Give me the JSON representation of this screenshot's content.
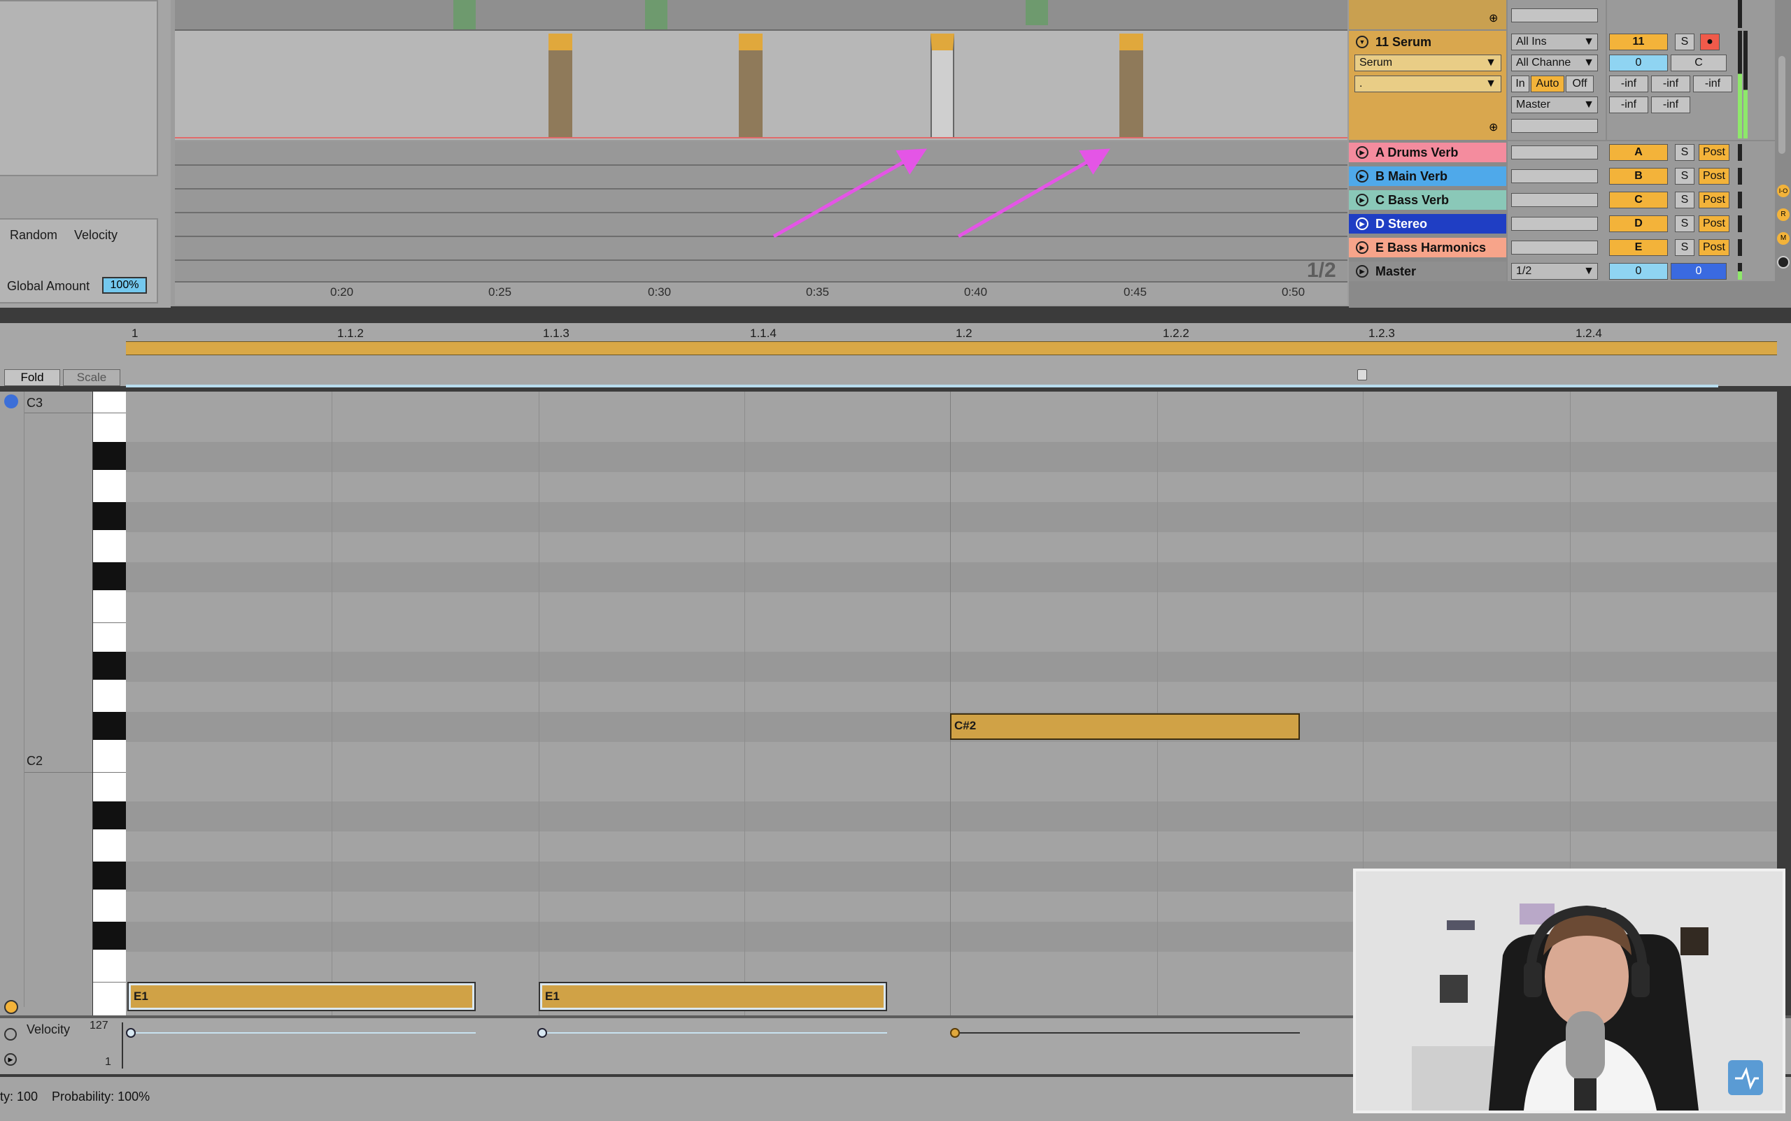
{
  "left_panel": {
    "random_label": "Random",
    "velocity_label": "Velocity",
    "global_amount_label": "Global Amount",
    "global_amount_value": "100%"
  },
  "arrangement": {
    "time_labels": [
      "0:20",
      "0:25",
      "0:30",
      "0:35",
      "0:40",
      "0:45",
      "0:50"
    ],
    "zoom_readout": "1/2",
    "annotation_arrow_color": "#e455e6"
  },
  "mixer": {
    "serum_track": {
      "name": "11 Serum",
      "instrument": "Serum",
      "sub_chain": ".",
      "input_type": "All Ins",
      "input_channel": "All Channe",
      "monitor_in": "In",
      "monitor_auto": "Auto",
      "monitor_off": "Off",
      "output": "Master",
      "track_number": "11",
      "solo": "S",
      "volume": "0",
      "pan": "C",
      "peak1": "-inf",
      "peak2": "-inf",
      "peak3": "-inf",
      "peak4": "-inf",
      "peak5": "-inf"
    },
    "returns": [
      {
        "name": "A Drums Verb",
        "letter": "A",
        "solo": "S",
        "mode": "Post",
        "color": "#f48c9e"
      },
      {
        "name": "B Main Verb",
        "letter": "B",
        "solo": "S",
        "mode": "Post",
        "color": "#4fa9ea"
      },
      {
        "name": "C Bass Verb",
        "letter": "C",
        "solo": "S",
        "mode": "Post",
        "color": "#8ac8b8"
      },
      {
        "name": "D Stereo",
        "letter": "D",
        "solo": "S",
        "mode": "Post",
        "color": "#1f3ec4"
      },
      {
        "name": "E Bass Harmonics",
        "letter": "E",
        "solo": "S",
        "mode": "Post",
        "color": "#f7a48a"
      }
    ],
    "master": {
      "name": "Master",
      "cue": "1/2",
      "volume": "0",
      "pan": "0"
    },
    "side_buttons": [
      "I-O",
      "R",
      "M"
    ]
  },
  "piano_roll": {
    "fold_label": "Fold",
    "scale_label": "Scale",
    "ruler_labels": [
      "1",
      "1.1.2",
      "1.1.3",
      "1.1.4",
      "1.2",
      "1.2.2",
      "1.2.3",
      "1.2.4"
    ],
    "octave_labels": [
      "C3",
      "C2"
    ],
    "notes": [
      {
        "label": "C#2"
      },
      {
        "label": "E1"
      },
      {
        "label": "E1"
      }
    ],
    "note_color": "#d0a246"
  },
  "velocity_lane": {
    "label": "Velocity",
    "max": "127",
    "min": "1"
  },
  "status_bar": {
    "text": "ty: 100    Probability: 100%"
  }
}
